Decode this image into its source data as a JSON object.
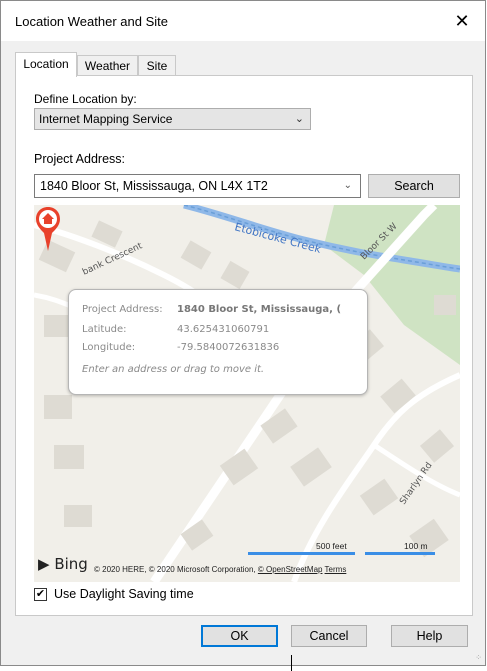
{
  "window": {
    "title": "Location Weather and Site",
    "close_icon": "close-icon"
  },
  "tabs": [
    {
      "label": "Location",
      "active": true
    },
    {
      "label": "Weather",
      "active": false
    },
    {
      "label": "Site",
      "active": false
    }
  ],
  "location": {
    "define_label": "Define Location by:",
    "define_value": "Internet Mapping Service",
    "address_label": "Project Address:",
    "address_value": "1840 Bloor St, Mississauga, ON L4X 1T2",
    "search_button": "Search"
  },
  "map": {
    "popup": {
      "address_label": "Project Address:",
      "address_value": "1840 Bloor St, Mississauga, (",
      "latitude_label": "Latitude:",
      "latitude_value": "43.625431060791",
      "longitude_label": "Longitude:",
      "longitude_value": "-79.5840072631836",
      "hint": "Enter an address or drag to move it."
    },
    "labels": {
      "creek": "Etobicoke Creek",
      "bloor": "Bloor St W",
      "crescent": "bank Crescent",
      "sharlyn": "Sharlyn Rd"
    },
    "bing": "Bing",
    "copyright_text": "© 2020 HERE, © 2020 Microsoft Corporation,",
    "osm_link": "© OpenStreetMap",
    "terms_link": "Terms",
    "scale_feet": "500 feet",
    "scale_m": "100 m"
  },
  "options": {
    "daylight_label": "Use Daylight Saving time",
    "daylight_checked": "✔"
  },
  "footer": {
    "ok": "OK",
    "cancel": "Cancel",
    "help": "Help"
  },
  "colors": {
    "accent": "#0078d7",
    "map_park": "#cfe3c3",
    "creek_water": "#8fb8e8",
    "pin_red": "#e8412b"
  }
}
